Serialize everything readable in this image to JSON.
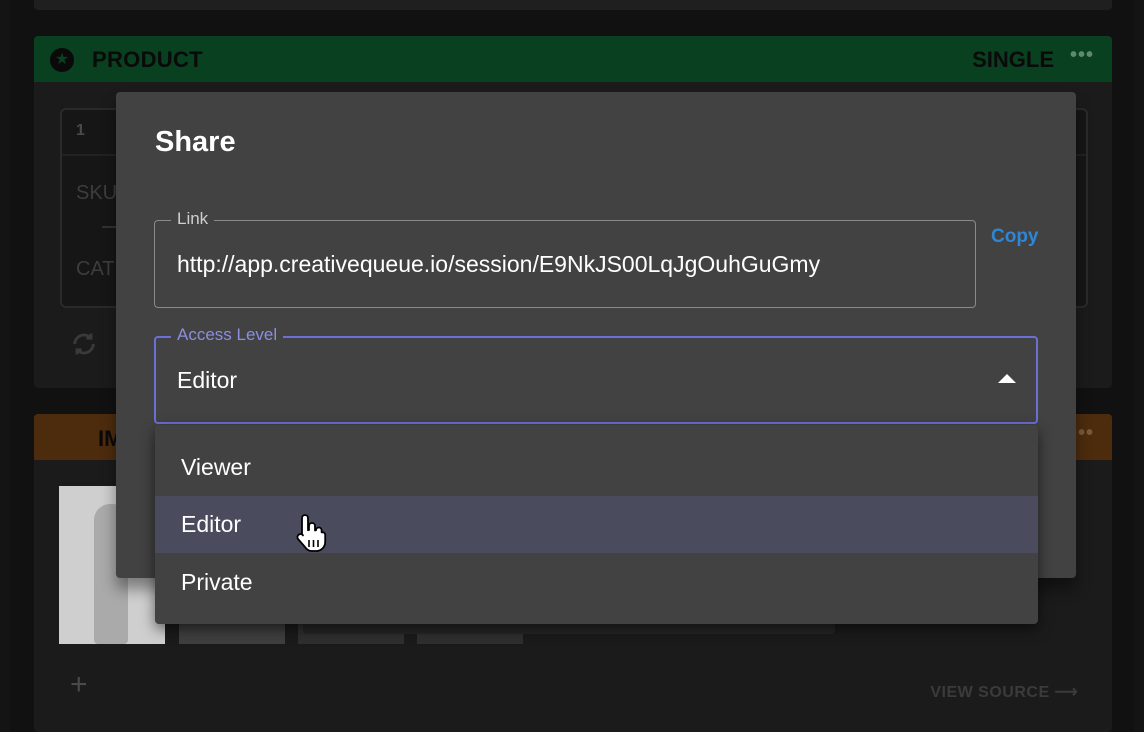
{
  "background": {
    "product_card": {
      "title": "PRODUCT",
      "type": "SINGLE",
      "more": "•••",
      "variant_number": "1",
      "field_sku": "SKU",
      "field_cat": "CAT"
    },
    "images_card": {
      "title": "IM",
      "more": "•••",
      "view_source": "VIEW SOURCE ⟶"
    }
  },
  "dialog": {
    "title": "Share",
    "link": {
      "label": "Link",
      "value": "http://app.creativequeue.io/session/E9NkJS00LqJgOuhGuGmy",
      "copy_label": "Copy"
    },
    "access_level": {
      "label": "Access Level",
      "value": "Editor"
    }
  },
  "menu": {
    "options": [
      "Viewer",
      "Editor",
      "Private"
    ],
    "selected": "Editor"
  },
  "colors": {
    "accent": "#6b6fd6",
    "link_blue": "#2f86d4",
    "dialog_bg": "#424242",
    "product_green": "#09401f",
    "images_orange": "#4d2c0e"
  }
}
